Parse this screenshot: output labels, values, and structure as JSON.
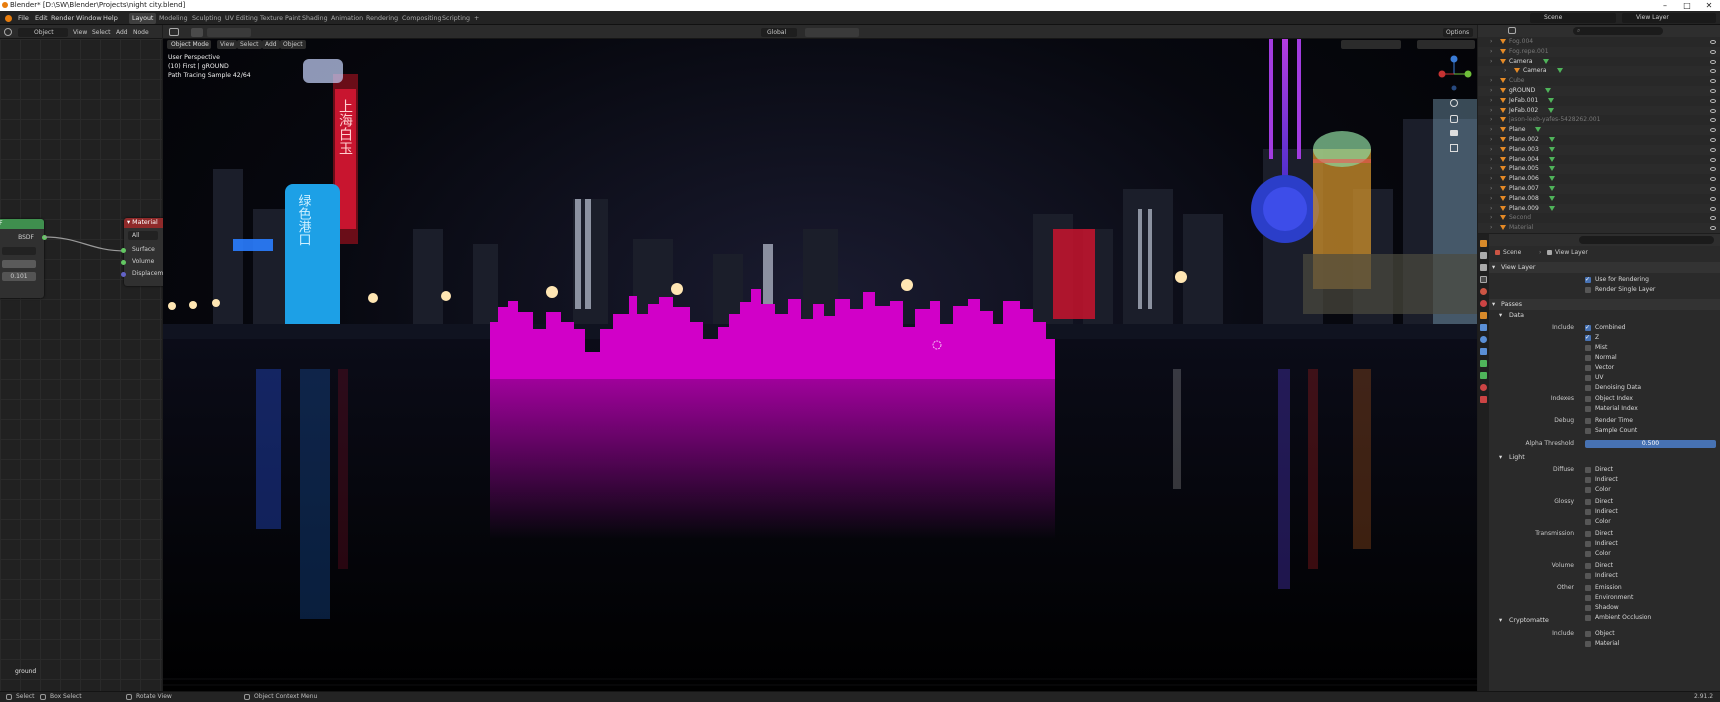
{
  "window": {
    "title": "Blender* [D:\\SW\\Blender\\Projects\\night city.blend]",
    "controls": [
      "–",
      "□",
      "✕"
    ]
  },
  "menubar": {
    "menus": [
      "File",
      "Edit",
      "Render",
      "Window",
      "Help"
    ],
    "workspaces": [
      "Layout",
      "Modeling",
      "Sculpting",
      "UV Editing",
      "Texture Paint",
      "Shading",
      "Animation",
      "Rendering",
      "Compositing",
      "Scripting"
    ],
    "active_workspace": "Layout",
    "add_tab": "+",
    "scene_label": "Scene",
    "view_layer_label": "View Layer"
  },
  "node_editor": {
    "header": {
      "mode": "Object",
      "menus": [
        "View",
        "Select",
        "Add",
        "Node"
      ]
    },
    "bsdf_node": {
      "title": "F",
      "output": "BSDF",
      "value": "0.101"
    },
    "material_node": {
      "title": "Material",
      "target": "All",
      "inputs": [
        "Surface",
        "Volume",
        "Displacem"
      ]
    },
    "material_name": "ground"
  },
  "viewport": {
    "header": {
      "mode": "Object Mode",
      "menus": [
        "View",
        "Select",
        "Add",
        "Object"
      ],
      "transform": "Global",
      "options": "Options"
    },
    "overlay": {
      "line1": "User Perspective",
      "line2": "(10) First | gROUND",
      "line3": "Path Tracing Sample 42/64"
    },
    "sign_text_1": "上海白玉",
    "sign_text_2": "绿色港口"
  },
  "outliner": {
    "rows": [
      {
        "name": "Fog.004",
        "dim": true
      },
      {
        "name": "Fog.repe.001",
        "dim": true
      },
      {
        "name": "Camera",
        "dim": false
      },
      {
        "name": "Camera",
        "dim": false
      },
      {
        "name": "Cube",
        "dim": true
      },
      {
        "name": "gROUND",
        "dim": false
      },
      {
        "name": "JeFab.001",
        "dim": false
      },
      {
        "name": "JeFab.002",
        "dim": false
      },
      {
        "name": "jason-leeb-yafes-5428262.001",
        "dim": true
      },
      {
        "name": "Plane",
        "dim": false
      },
      {
        "name": "Plane.002",
        "dim": false
      },
      {
        "name": "Plane.003",
        "dim": false
      },
      {
        "name": "Plane.004",
        "dim": false
      },
      {
        "name": "Plane.005",
        "dim": false
      },
      {
        "name": "Plane.006",
        "dim": false
      },
      {
        "name": "Plane.007",
        "dim": false
      },
      {
        "name": "Plane.008",
        "dim": false
      },
      {
        "name": "Plane.009",
        "dim": false
      },
      {
        "name": "Second",
        "dim": true
      },
      {
        "name": "Material",
        "dim": true
      }
    ]
  },
  "properties": {
    "breadcrumb": [
      "Scene",
      "View Layer"
    ],
    "view_layer_header": "View Layer",
    "use_for_rendering": "Use for Rendering",
    "render_single_layer": "Render Single Layer",
    "passes_header": "Passes",
    "data_header": "Data",
    "include_label": "Include",
    "data_items": [
      {
        "label": "Combined",
        "checked": true
      },
      {
        "label": "Z",
        "checked": true
      },
      {
        "label": "Mist",
        "checked": false
      },
      {
        "label": "Normal",
        "checked": false
      },
      {
        "label": "Vector",
        "checked": false
      },
      {
        "label": "UV",
        "checked": false
      },
      {
        "label": "Denoising Data",
        "checked": false
      }
    ],
    "indexes_label": "Indexes",
    "indexes": [
      "Object Index",
      "Material Index"
    ],
    "debug_label": "Debug",
    "debug": [
      "Render Time",
      "Sample Count"
    ],
    "alpha_threshold_label": "Alpha Threshold",
    "alpha_threshold_value": "0.500",
    "light_header": "Light",
    "diffuse_label": "Diffuse",
    "glossy_label": "Glossy",
    "transmission_label": "Transmission",
    "volume_label": "Volume",
    "other_label": "Other",
    "light_sub": [
      "Direct",
      "Indirect",
      "Color"
    ],
    "volume_sub": [
      "Direct",
      "Indirect"
    ],
    "other_sub": [
      "Emission",
      "Environment",
      "Shadow",
      "Ambient Occlusion"
    ],
    "cryptomatte_header": "Cryptomatte",
    "crypto_include_label": "Include",
    "crypto_items": [
      "Object",
      "Material"
    ]
  },
  "statusbar": {
    "items": [
      "Select",
      "Box Select",
      "Rotate View",
      "Object Context Menu"
    ],
    "version": "2.91.2"
  },
  "colors": {
    "accent": "#4772b3",
    "skyline_magenta": "#d100c8",
    "node_green": "#3f8f4e",
    "node_red": "#8f2a2a"
  }
}
